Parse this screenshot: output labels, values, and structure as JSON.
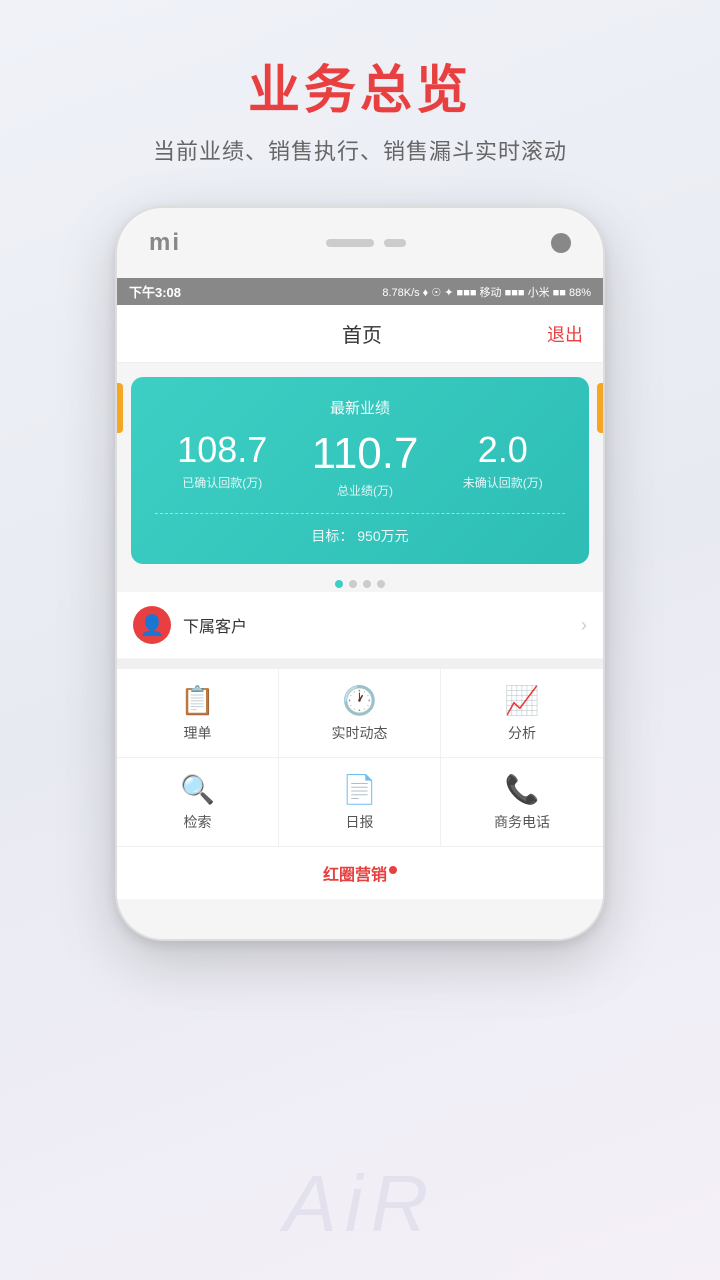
{
  "page": {
    "title_main": "业务总览",
    "title_sub": "当前业绩、销售执行、销售漏斗实时滚动"
  },
  "status_bar": {
    "time": "下午3:08",
    "info": "8.78K/s ♦ ☉ ✦ ■■■ 移动 ■■■ 小米 ■■ 88%"
  },
  "header": {
    "title": "首页",
    "logout": "退出"
  },
  "performance": {
    "card_title": "最新业绩",
    "confirmed": "108.7",
    "confirmed_label": "已确认回款(万)",
    "total": "110.7",
    "total_label": "总业绩(万)",
    "unconfirmed": "2.0",
    "unconfirmed_label": "未确认回款(万)",
    "target_label": "目标：",
    "target_value": "950万元"
  },
  "customer": {
    "label": "下属客户"
  },
  "menu": {
    "items": [
      {
        "icon": "📋",
        "label": "理单"
      },
      {
        "icon": "🕐",
        "label": "实时动态"
      },
      {
        "icon": "📈",
        "label": "分析"
      },
      {
        "icon": "🔍",
        "label": "检索"
      },
      {
        "icon": "📄",
        "label": "日报"
      },
      {
        "icon": "📞",
        "label": "商务电话"
      }
    ]
  },
  "brand": {
    "text": "红圈营销",
    "dot": "●"
  },
  "watermark": {
    "text": "AiR"
  }
}
